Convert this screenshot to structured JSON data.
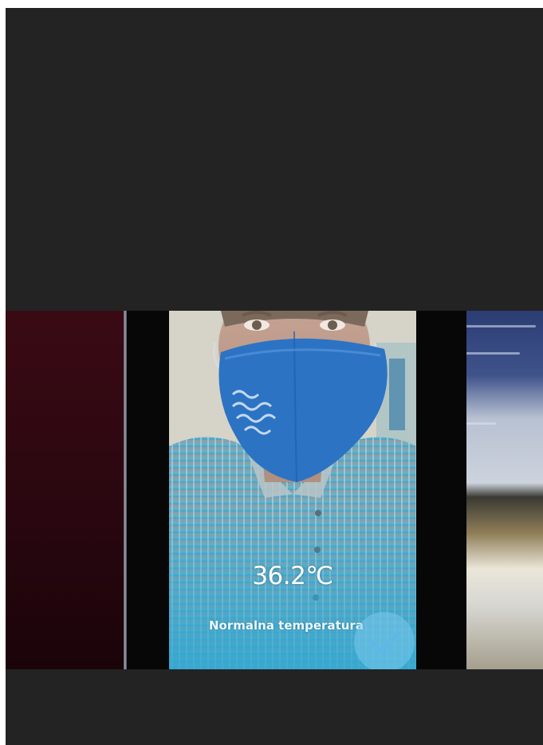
{
  "photo": {
    "subject": "person-wearing-blue-face-mask",
    "mask_color": "#2c73c4"
  },
  "device_screen": {
    "temperature": "36.2℃",
    "status": "Normalna temperatura",
    "status_icon": "checkmark-icon",
    "accent_color": "#2fa7d2"
  }
}
